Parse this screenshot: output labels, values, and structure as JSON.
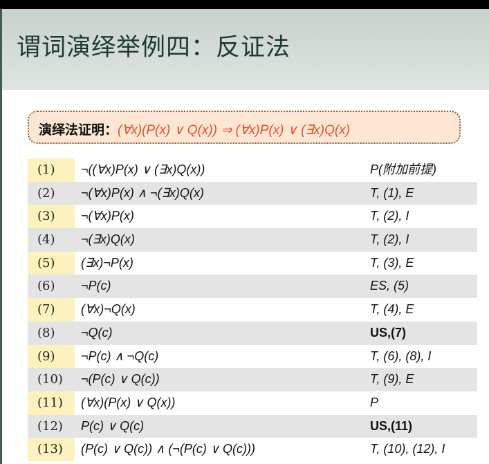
{
  "slide": {
    "title": "谓词演绎举例四：反证法",
    "callout": {
      "label": "演绎法证明：",
      "formula": "(∀x)(P(x) ∨ Q(x)) ⇒ (∀x)P(x) ∨ (∃x)Q(x)"
    },
    "colors": {
      "accent": "#e2502a",
      "number_highlight": "#fdf2bd",
      "stripe": "#e4e4e4",
      "callout_bg": "#fde6d4"
    },
    "rows": [
      {
        "num": "(1)",
        "formula": "¬((∀x)P(x) ∨ (∃x)Q(x))",
        "reason": "P(附加前提)"
      },
      {
        "num": "(2)",
        "formula": "¬(∀x)P(x) ∧ ¬(∃x)Q(x)",
        "reason": "T, (1), E"
      },
      {
        "num": "(3)",
        "formula": "¬(∀x)P(x)",
        "reason": "T, (2), I"
      },
      {
        "num": "(4)",
        "formula": "¬(∃x)Q(x)",
        "reason": "T, (2), I"
      },
      {
        "num": "(5)",
        "formula": "(∃x)¬P(x)",
        "reason": "T, (3), E"
      },
      {
        "num": "(6)",
        "formula": "¬P(c)",
        "reason": "ES, (5)"
      },
      {
        "num": "(7)",
        "formula": "(∀x)¬Q(x)",
        "reason": "T, (4), E"
      },
      {
        "num": "(8)",
        "formula": "¬Q(c)",
        "reason": " US,(7)"
      },
      {
        "num": "(9)",
        "formula": "¬P(c) ∧ ¬Q(c)",
        "reason": "T, (6), (8), I"
      },
      {
        "num": "(10)",
        "formula": "¬(P(c) ∨ Q(c))",
        "reason": "T, (9), E"
      },
      {
        "num": "(11)",
        "formula": "(∀x)(P(x) ∨ Q(x))",
        "reason": "P"
      },
      {
        "num": "(12)",
        "formula": "P(c) ∨ Q(c)",
        "reason": "US,(11)"
      },
      {
        "num": "(13)",
        "formula": "(P(c) ∨ Q(c)) ∧ (¬(P(c) ∨ Q(c)))",
        "reason": "T, (10), (12), I"
      }
    ]
  }
}
